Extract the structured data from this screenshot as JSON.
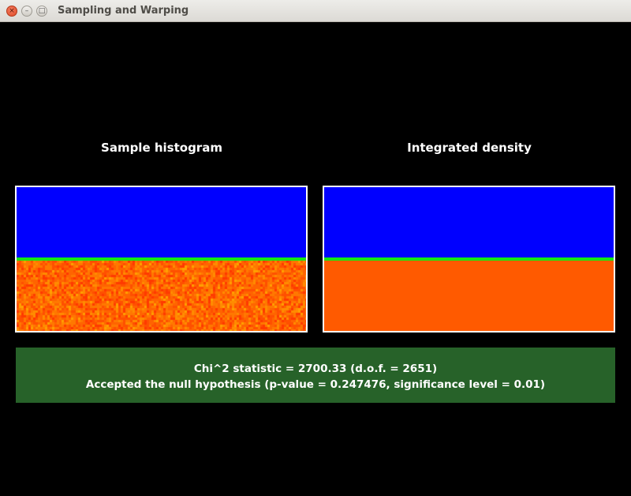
{
  "window": {
    "title": "Sampling and Warping",
    "close_glyph": "×",
    "minimize_glyph": "–",
    "maximize_glyph": "□"
  },
  "left_panel": {
    "title": "Sample histogram"
  },
  "right_panel": {
    "title": "Integrated density"
  },
  "results": {
    "line1": "Chi^2 statistic = 2700.33 (d.o.f. = 2651)",
    "line2": "Accepted the null hypothesis (p-value = 0.247476, significance level = 0.01)"
  },
  "colors": {
    "background": "#000000",
    "low_density": "#0000ff",
    "boundary": "#14e614",
    "high_density": "#ff5a00",
    "result_box": "#276229"
  }
}
